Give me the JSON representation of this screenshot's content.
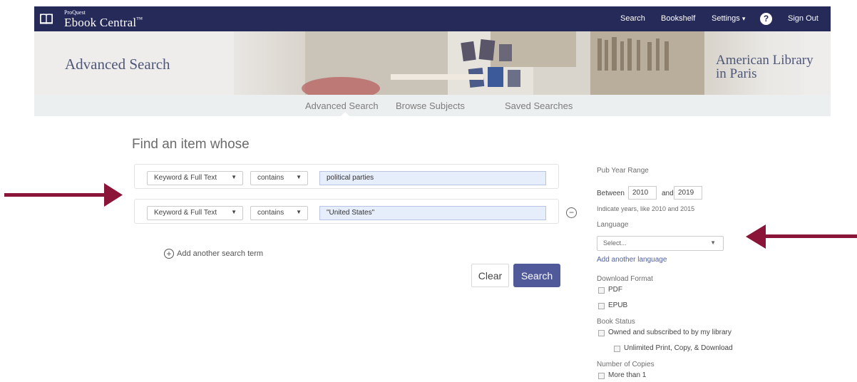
{
  "topbar": {
    "brand_small": "ProQuest",
    "brand_big": "Ebook Central",
    "brand_tm": "™",
    "nav": {
      "search": "Search",
      "bookshelf": "Bookshelf",
      "settings": "Settings",
      "settings_caret": "▾",
      "help": "?",
      "signout": "Sign Out"
    }
  },
  "banner": {
    "title": "Advanced Search",
    "library_line1": "American Library",
    "library_line2": "in Paris"
  },
  "subnav": {
    "advanced": "Advanced Search",
    "browse": "Browse Subjects",
    "saved": "Saved Searches"
  },
  "main": {
    "heading": "Find an item whose",
    "rows": [
      {
        "field": "Keyword & Full Text",
        "operator": "contains",
        "term": "political parties"
      },
      {
        "field": "Keyword & Full Text",
        "operator": "contains",
        "term": "\"United States\""
      }
    ],
    "dropdown_arrow": "▼",
    "remove_symbol": "−",
    "add_symbol": "+",
    "add_term": "Add another search term",
    "clear": "Clear",
    "search": "Search"
  },
  "filters": {
    "pub_year_label": "Pub Year Range",
    "between": "Between",
    "from_year": "2010",
    "and": "and",
    "to_year": "2019",
    "year_hint": "Indicate years, like 2010 and 2015",
    "language_label": "Language",
    "language_placeholder": "Select...",
    "add_language": "Add another language",
    "download_label": "Download Format",
    "pdf": "PDF",
    "epub": "EPUB",
    "status_label": "Book Status",
    "owned": "Owned and subscribed to by my library",
    "unlimited": "Unlimited Print, Copy, & Download",
    "copies_label": "Number of Copies",
    "more_than_one": "More than 1"
  },
  "colors": {
    "topbar": "#252a59",
    "accent": "#505a9a",
    "arrow": "#8b1538"
  }
}
